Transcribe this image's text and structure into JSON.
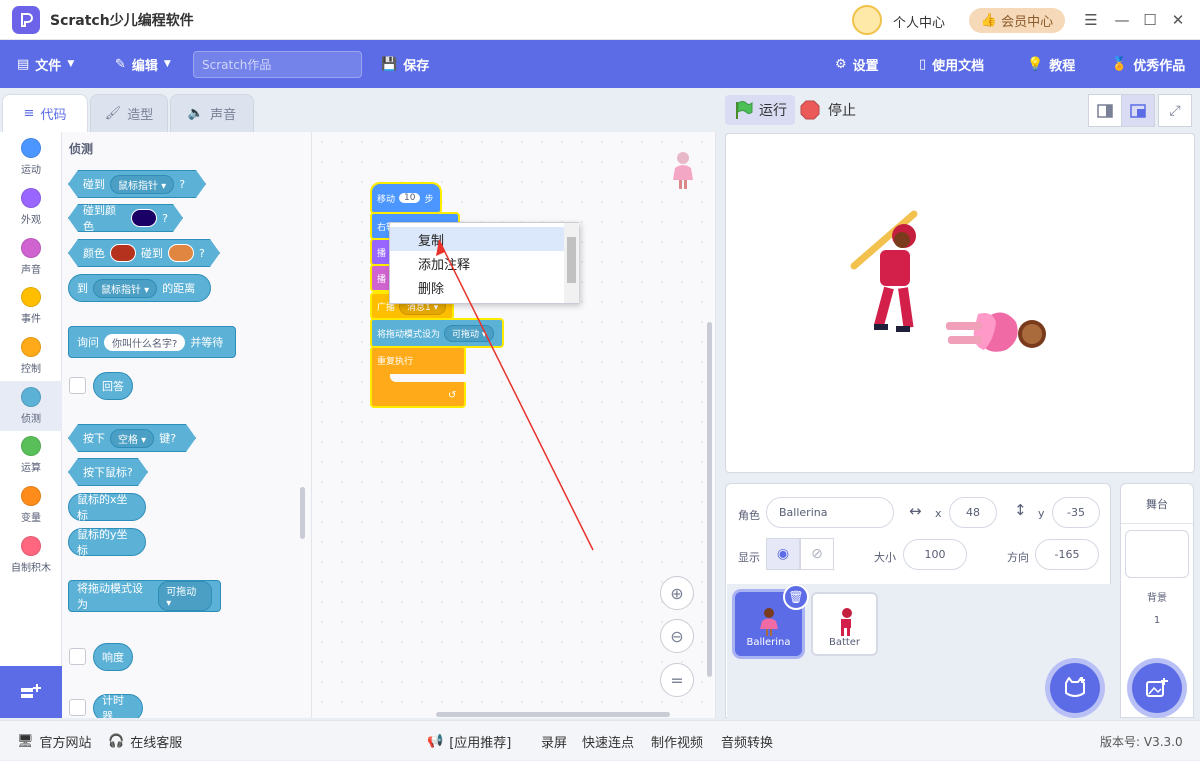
{
  "app": {
    "title": "Scratch少儿编程软件",
    "personal_center": "个人中心",
    "vip_center": "会员中心"
  },
  "menubar": {
    "file": "文件",
    "edit": "编辑",
    "project_placeholder": "Scratch作品",
    "save": "保存",
    "settings": "设置",
    "docs": "使用文档",
    "tutorial": "教程",
    "showcase": "优秀作品"
  },
  "tabs": [
    {
      "label": "代码"
    },
    {
      "label": "造型"
    },
    {
      "label": "声音"
    }
  ],
  "categories": [
    {
      "label": "运动",
      "color": "#4c97ff"
    },
    {
      "label": "外观",
      "color": "#9966ff"
    },
    {
      "label": "声音",
      "color": "#cf63cf"
    },
    {
      "label": "事件",
      "color": "#ffbf00"
    },
    {
      "label": "控制",
      "color": "#ffab19"
    },
    {
      "label": "侦测",
      "color": "#5cb1d6"
    },
    {
      "label": "运算",
      "color": "#59c059"
    },
    {
      "label": "变量",
      "color": "#ff8c1a"
    },
    {
      "label": "自制积木",
      "color": "#ff6680"
    }
  ],
  "palette": {
    "title": "侦测",
    "touching": "碰到",
    "mouse_pointer": "鼠标指针",
    "q": "?",
    "touching_color": "碰到颜色",
    "color": "颜色",
    "touching2": "碰到",
    "distance_to": "到",
    "distance_suffix": "的距离",
    "ask": "询问",
    "ask_default": "你叫什么名字?",
    "and_wait": "并等待",
    "answer": "回答",
    "key_pressed_prefix": "按下",
    "space": "空格",
    "key_suffix": "键?",
    "mouse_down": "按下鼠标?",
    "mouse_x": "鼠标的x坐标",
    "mouse_y": "鼠标的y坐标",
    "drag_mode": "将拖动模式设为",
    "draggable": "可拖动",
    "loudness": "响度",
    "timer": "计时器"
  },
  "workspace": {
    "move": "移动",
    "steps_value": "10",
    "steps": "步",
    "turn_right": "右转",
    "broadcast": "广播",
    "message": "消息1",
    "drag_mode": "将拖动模式设为",
    "draggable": "可拖动",
    "forever": "重复执行",
    "purple1": "播",
    "purple2": "播"
  },
  "context_menu": {
    "items": [
      "复制",
      "添加注释",
      "删除"
    ]
  },
  "stage_controls": {
    "run": "运行",
    "stop": "停止"
  },
  "sprite_info": {
    "sprite_label": "角色",
    "sprite_name": "Ballerina",
    "x_label": "x",
    "x_value": "48",
    "y_label": "y",
    "y_value": "-35",
    "show_label": "显示",
    "size_label": "大小",
    "size_value": "100",
    "direction_label": "方向",
    "direction_value": "-165"
  },
  "sprites": [
    {
      "name": "Ballerina"
    },
    {
      "name": "Batter"
    }
  ],
  "stage_panel": {
    "title": "舞台",
    "backdrop_label": "背景",
    "backdrop_count": "1"
  },
  "statusbar": {
    "website": "官方网站",
    "support": "在线客服",
    "app_recommend": "[应用推荐]",
    "record": "录屏",
    "quick_connect": "快速连点",
    "make_video": "制作视频",
    "audio_convert": "音频转换",
    "version": "版本号: V3.3.0"
  },
  "colors": {
    "accent": "#5b6ce6",
    "sensing": "#5cb1d6",
    "control": "#ffab19"
  }
}
